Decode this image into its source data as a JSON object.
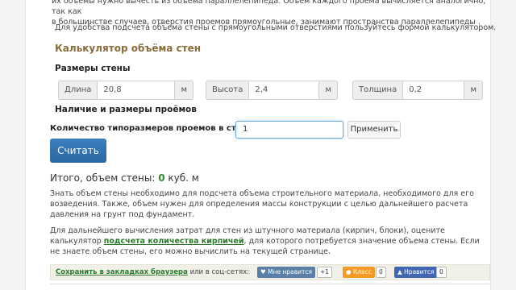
{
  "text": {
    "cut_paragraph_line1": "их объемы нужно вычесть из объема параллелепипеда. Объем каждого проема вычисляется аналогично, так как",
    "cut_paragraph_line2": "в большинстве случаев, отверстия проемов прямоугольные, занимают пространства параллелепипеды .",
    "intro": "Для удобства подсчета объема стены с прямоугольными отверстиями пользуйтесь формой калькулятором."
  },
  "calculator": {
    "title": "Калькулятор объёма стен",
    "wall_size_title": "Размеры стены",
    "fields": [
      {
        "label": "Длина",
        "value": "20,8",
        "unit": "м"
      },
      {
        "label": "Высота",
        "value": "2,4",
        "unit": "м"
      },
      {
        "label": "Толщина",
        "value": "0,2",
        "unit": "м"
      }
    ],
    "openings_title": "Наличие и размеры проёмов",
    "count_label": "Количество типоразмеров проемов в стене",
    "count_value": "1",
    "apply_label": "Применить",
    "calc_label": "Считать"
  },
  "result": {
    "prefix": "Итого, объем стены:",
    "value": "0",
    "unit": "куб. м"
  },
  "paragraphs": {
    "know": "Знать объем стены необходимо для подсчета объема строительного материала, необходимого для его возведения. Также, объем нужен для определения массы конструкции с целью дальнейшего расчета давления на грунт под фундамент.",
    "bricks_before": "Для дальнейшего вычисления затрат для стен из штучного материала (кирпич, блоки), оцените калькулятор ",
    "bricks_link": "подсчета количества кирпичей",
    "bricks_after": ", для которого потребуется значение объема стены. Если не знаете объем стены, его можно вычислить на текущей странице."
  },
  "share": {
    "bookmark": "Сохранить в закладках браузера",
    "or_social": "или в соц-сетях:",
    "vk_label": "Мне нравится",
    "vk_count": "+1",
    "ok_label": "Класс",
    "ok_count": "0",
    "fb_label": "Нравится",
    "fb_count": "0"
  },
  "colors": {
    "accent_title": "#8a6d3b",
    "primary_button": "#2a67a2",
    "link_green": "#2d7a2d",
    "vk": "#5b7fa6",
    "ok": "#f59a23",
    "fb": "#4267b2"
  }
}
